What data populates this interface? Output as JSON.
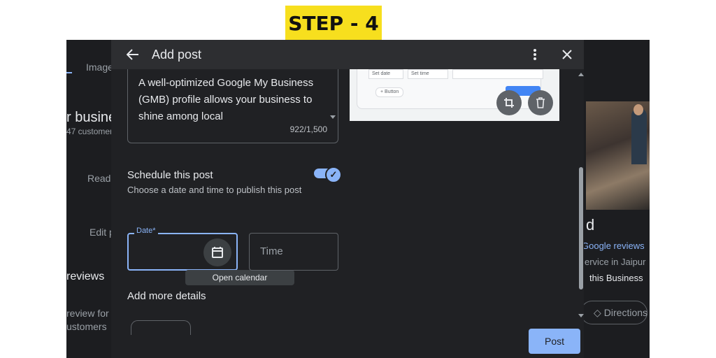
{
  "step_label": "STEP - 4",
  "background": {
    "tab_text": "Image",
    "business_title": "r busine",
    "customers_text": "47 customer",
    "read_text": "Read",
    "edit_text": "Edit p",
    "reviews_heading": "reviews",
    "review_line1": "review for",
    "review_line2": "ustomers",
    "panel_letter": "d",
    "google_reviews": "Google reviews",
    "service_text": "ervice in Jaipur",
    "this_business": "this Business",
    "directions": "Directions"
  },
  "dialog": {
    "title": "Add post",
    "description": "A well-optimized Google My Business (GMB) profile allows your business to shine among local",
    "char_counter": "922/1,500",
    "preview": {
      "set_date": "Set date",
      "set_time": "Set time",
      "button": "+ Button"
    },
    "schedule_title": "Schedule this post",
    "schedule_subtitle": "Choose a date and time to publish this post",
    "schedule_enabled": true,
    "date_label": "Date*",
    "date_value": "",
    "tooltip": "Open calendar",
    "time_placeholder": "Time",
    "add_more_details": "Add more details",
    "post_button": "Post"
  },
  "icons": {
    "back": "arrow-left-icon",
    "more": "more-vert-icon",
    "close": "close-icon",
    "crop": "crop-icon",
    "delete": "trash-icon",
    "calendar": "calendar-icon",
    "check": "check-icon"
  },
  "colors": {
    "step_badge": "#f7df1e",
    "accent": "#8ab4f8",
    "dialog_bg": "#202124"
  }
}
